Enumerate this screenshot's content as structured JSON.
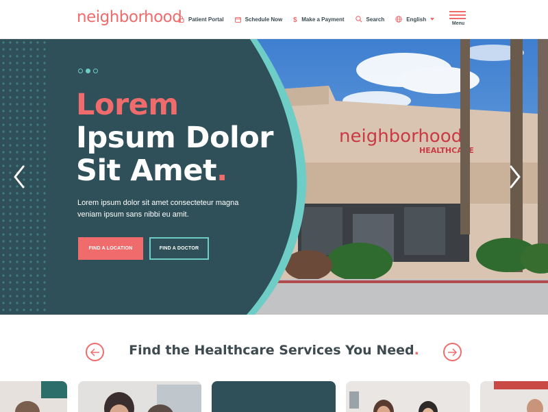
{
  "brand": {
    "logo_text": "neighborhood",
    "accent": "#f06b6b",
    "teal": "#6ecdc6",
    "dark": "#2f5059"
  },
  "nav": {
    "items": [
      {
        "label": "Patient Portal",
        "icon": "lock-icon"
      },
      {
        "label": "Schedule Now",
        "icon": "calendar-icon"
      },
      {
        "label": "Make a Payment",
        "icon": "dollar-icon"
      },
      {
        "label": "Search",
        "icon": "search-icon"
      },
      {
        "label": "English",
        "icon": "globe-icon"
      }
    ],
    "menu_label": "Menu"
  },
  "hero": {
    "slides": 3,
    "active_slide": 2,
    "title_line1": "Lorem",
    "title_line2": "Ipsum Dolor",
    "title_line3": "Sit Amet",
    "title_period": ".",
    "text": "Lorem ipsum dolor sit amet consecteteur magna veniam ipsum sans nibbi eu amit.",
    "btn_location": "Find a Location",
    "btn_doctor": "Find a Doctor",
    "sign_text": "neighborhood",
    "sign_subtext": "HEALTHCARE"
  },
  "services": {
    "title": "Find the Healthcare Services You Need",
    "period": "."
  }
}
